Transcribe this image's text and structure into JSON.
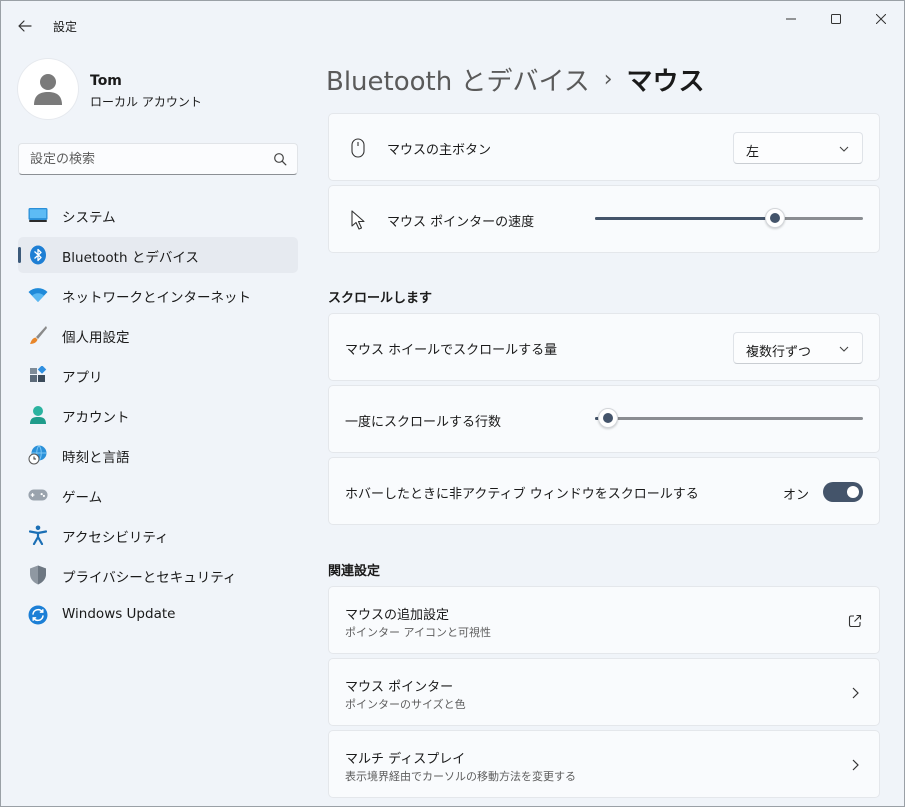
{
  "window": {
    "app_title": "設定",
    "back_icon": "back-arrow-icon",
    "controls": [
      "minimize-icon",
      "maximize-icon",
      "close-icon"
    ]
  },
  "profile": {
    "name": "Tom",
    "account_type": "ローカル アカウント"
  },
  "search": {
    "placeholder": "設定の検索",
    "value": ""
  },
  "sidebar": {
    "items": [
      {
        "label": "システム",
        "icon": "system-monitor-icon",
        "active": false
      },
      {
        "label": "Bluetooth とデバイス",
        "icon": "bluetooth-icon",
        "active": true
      },
      {
        "label": "ネットワークとインターネット",
        "icon": "wifi-icon",
        "active": false
      },
      {
        "label": "個人用設定",
        "icon": "paintbrush-icon",
        "active": false
      },
      {
        "label": "アプリ",
        "icon": "apps-icon",
        "active": false
      },
      {
        "label": "アカウント",
        "icon": "account-icon",
        "active": false
      },
      {
        "label": "時刻と言語",
        "icon": "globe-clock-icon",
        "active": false
      },
      {
        "label": "ゲーム",
        "icon": "gamepad-icon",
        "active": false
      },
      {
        "label": "アクセシビリティ",
        "icon": "accessibility-icon",
        "active": false
      },
      {
        "label": "プライバシーとセキュリティ",
        "icon": "shield-icon",
        "active": false
      },
      {
        "label": "Windows Update",
        "icon": "windows-update-icon",
        "active": false
      }
    ]
  },
  "breadcrumb": {
    "parent": "Bluetooth とデバイス",
    "separator": "›",
    "current": "マウス"
  },
  "settings": {
    "primary_button": {
      "label": "マウスの主ボタン",
      "icon": "mouse-icon",
      "value": "左"
    },
    "pointer_speed": {
      "label": "マウス ポインターの速度",
      "icon": "cursor-arrow-icon",
      "level": 0.67
    }
  },
  "scroll_section": {
    "title": "スクロールします",
    "wheel_amount": {
      "label": "マウス ホイールでスクロールする量",
      "value": "複数行ずつ"
    },
    "lines_per_scroll": {
      "label": "一度にスクロールする行数",
      "level": 0.05
    },
    "inactive_scroll": {
      "label": "ホバーしたときに非アクティブ ウィンドウをスクロールする",
      "state_label": "オン",
      "on": true
    }
  },
  "related_section": {
    "title": "関連設定",
    "items": [
      {
        "title": "マウスの追加設定",
        "subtitle": "ポインター アイコンと可視性",
        "trail_icon": "external-link-icon"
      },
      {
        "title": "マウス ポインター",
        "subtitle": "ポインターのサイズと色",
        "trail_icon": "chevron-right-icon"
      },
      {
        "title": "マルチ ディスプレイ",
        "subtitle": "表示境界経由でカーソルの移動方法を変更する",
        "trail_icon": "chevron-right-icon"
      }
    ]
  },
  "colors": {
    "accent": "#44546a",
    "background": "#f0f4f9",
    "card": "#f9fbfd"
  }
}
